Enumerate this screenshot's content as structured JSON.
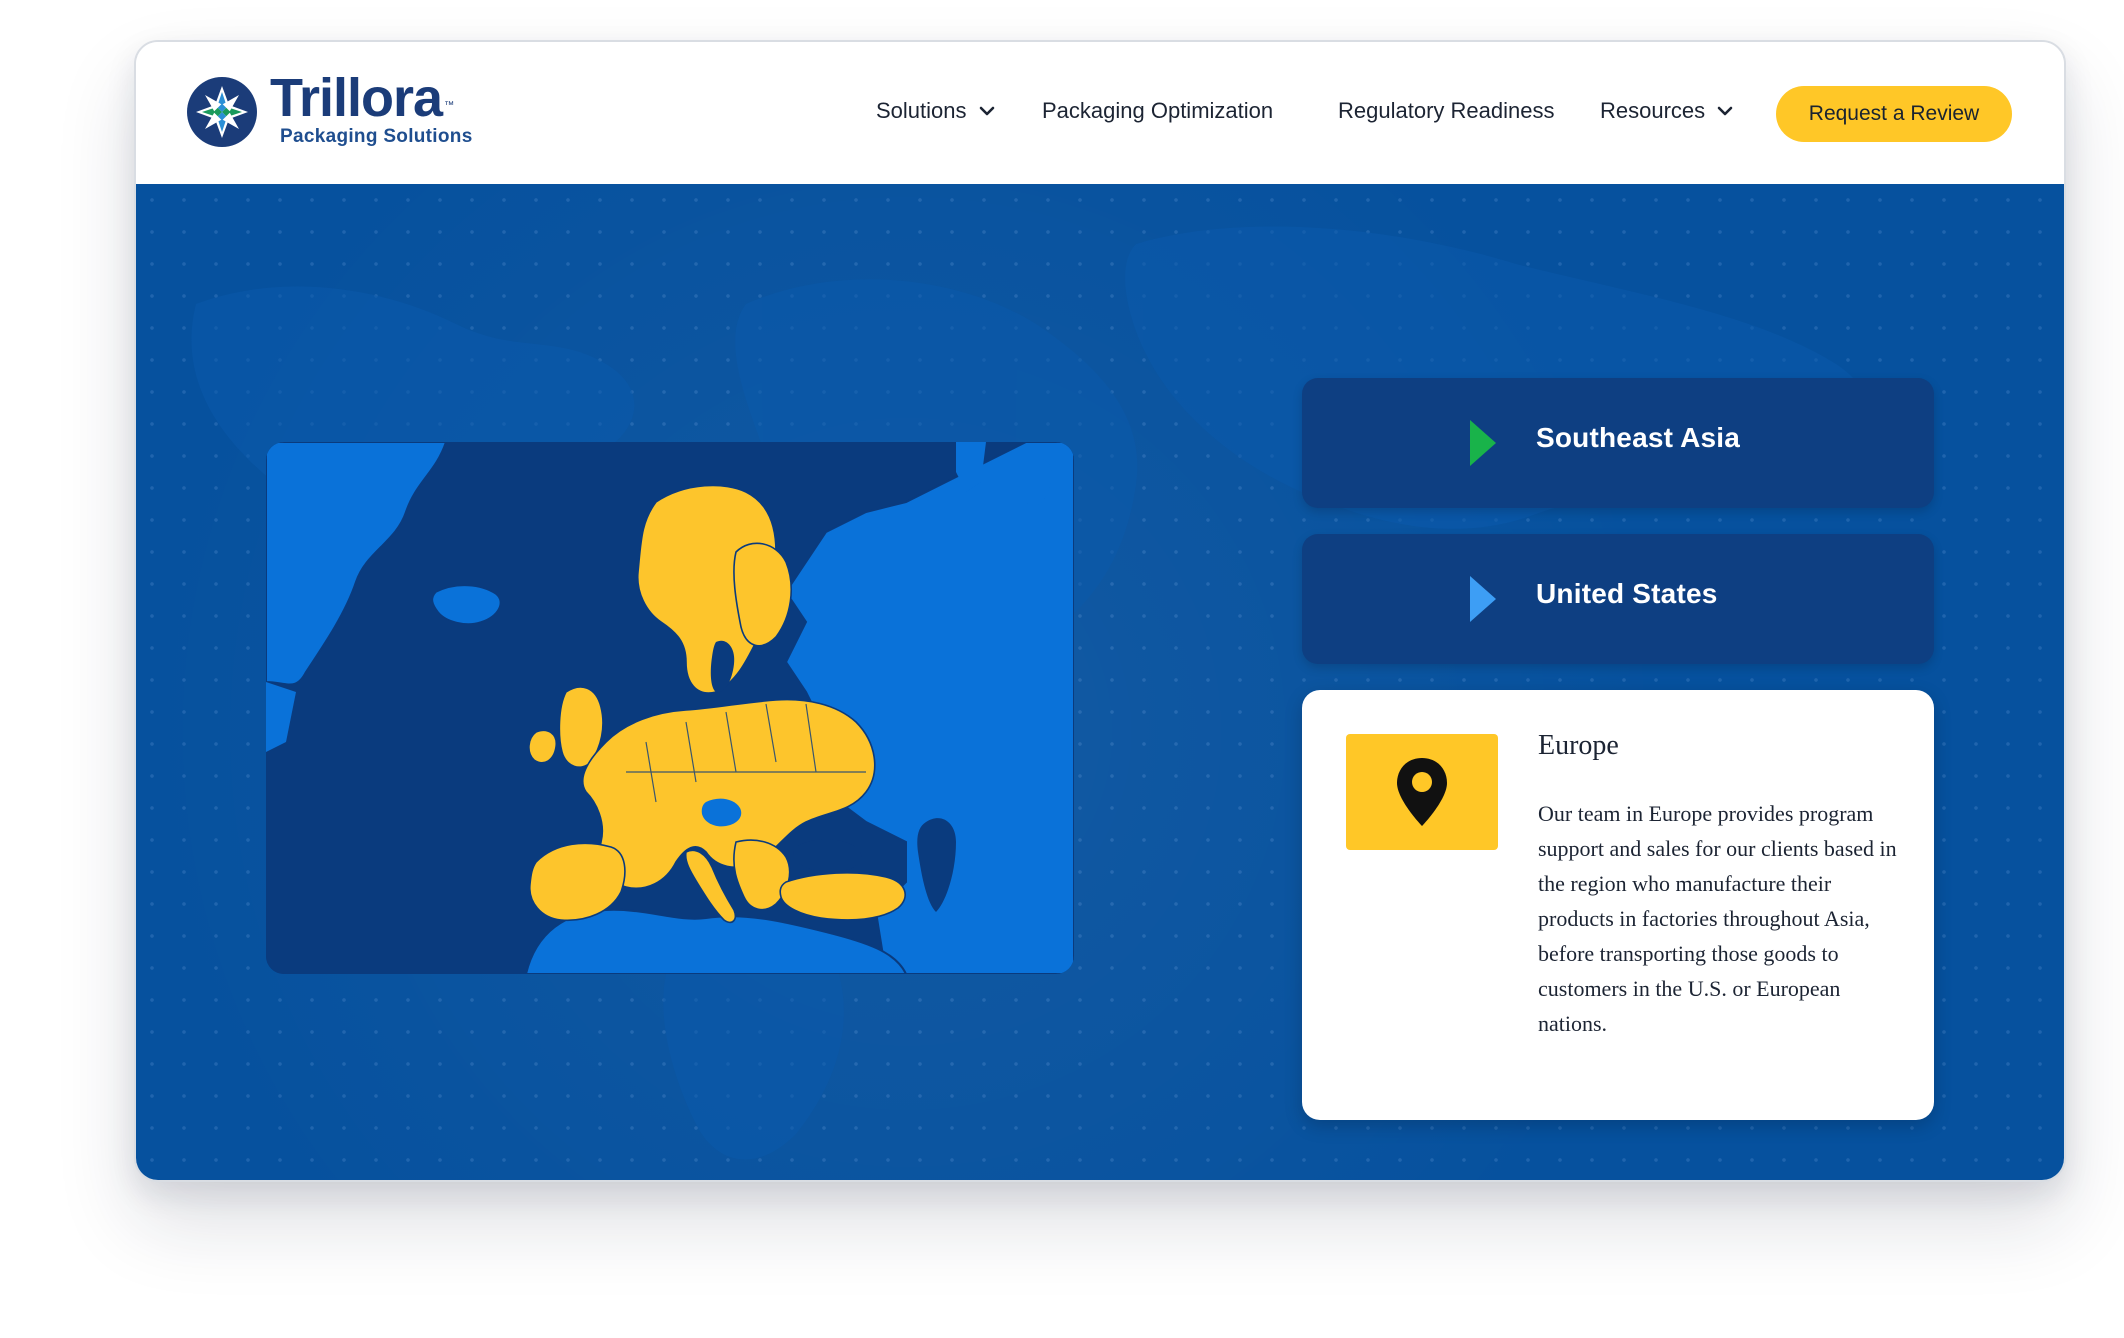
{
  "brand": {
    "name": "Trillora",
    "trademark": "™",
    "tagline": "Packaging Solutions"
  },
  "nav": {
    "items": [
      {
        "label": "Solutions",
        "has_dropdown": true
      },
      {
        "label": "Packaging Optimization",
        "has_dropdown": false
      },
      {
        "label": "Regulatory Readiness",
        "has_dropdown": false
      },
      {
        "label": "Resources",
        "has_dropdown": true
      }
    ],
    "cta_label": "Request a Review"
  },
  "regions": {
    "tabs": [
      {
        "label": "Southeast Asia",
        "marker_color": "#19b34a"
      },
      {
        "label": "United States",
        "marker_color": "#3d9ef5"
      }
    ],
    "selected": {
      "title": "Europe",
      "description": "Our team in Europe provides program support and sales for our clients based in the region who manufacture their products in factories throughout Asia, before transporting those goods to customers in the U.S. or European nations."
    }
  },
  "icons": {
    "dropdown": "chevron-down-icon",
    "tab_marker": "triangle-right-icon",
    "location": "map-pin-icon",
    "logo": "star-logo-icon"
  },
  "colors": {
    "brand_navy": "#1b3c79",
    "accent_yellow": "#ffc727",
    "hero_blue": "#06519e",
    "tab_blue": "#0e3f82",
    "map_land": "#0a72d9",
    "map_sea": "#0a3b7e",
    "map_highlight": "#fdc52c"
  }
}
